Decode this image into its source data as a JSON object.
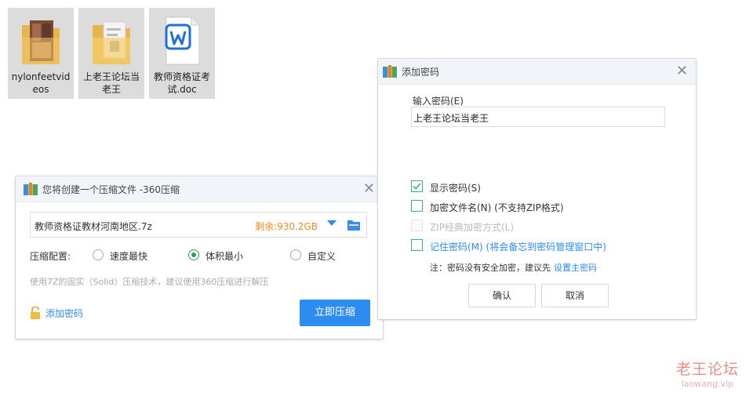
{
  "desktop": {
    "files": [
      {
        "name": "nylonfeetvideos",
        "icon": "video-folder-icon"
      },
      {
        "name": "上老王论坛当老王",
        "icon": "folder-icon"
      },
      {
        "name": "教师资格证考试.doc",
        "icon": "word-doc-icon"
      }
    ]
  },
  "compress_dialog": {
    "title": "您将创建一个压缩文件 -360压缩",
    "filename": "教师资格证教材河南地区.7z",
    "free_space": "剩余:930.2GB",
    "config_label": "压缩配置:",
    "options": [
      {
        "label": "速度最快",
        "selected": false
      },
      {
        "label": "体积最小",
        "selected": true
      },
      {
        "label": "自定义",
        "selected": false
      }
    ],
    "hint": "使用7Z的固实（Solid）压缩技术，建议使用360压缩进行解压",
    "add_password_label": "添加密码",
    "compress_button": "立即压缩"
  },
  "password_dialog": {
    "title": "添加密码",
    "input_label": "输入密码(E)",
    "password_value": "上老王论坛当老王",
    "options": [
      {
        "label": "显示密码(S)",
        "checked": true,
        "disabled": false
      },
      {
        "label": "加密文件名(N) (不支持ZIP格式)",
        "checked": false,
        "disabled": false
      },
      {
        "label": "ZIP经典加密方式(L)",
        "checked": false,
        "disabled": true
      },
      {
        "label": "记住密码(M) (将会备忘到密码管理窗口中)",
        "checked": false,
        "disabled": false
      }
    ],
    "note_prefix": "注：密码没有安全加密，建议先",
    "note_link": "设置主密码",
    "ok_button": "确认",
    "cancel_button": "取消"
  },
  "watermark": {
    "name": "老王论坛",
    "domain": "laowang.vip"
  },
  "colors": {
    "accent_blue": "#2d8cf0",
    "free_space_orange": "#f08a24",
    "check_green": "#3cb371",
    "watermark_red": "#e07b7b"
  }
}
